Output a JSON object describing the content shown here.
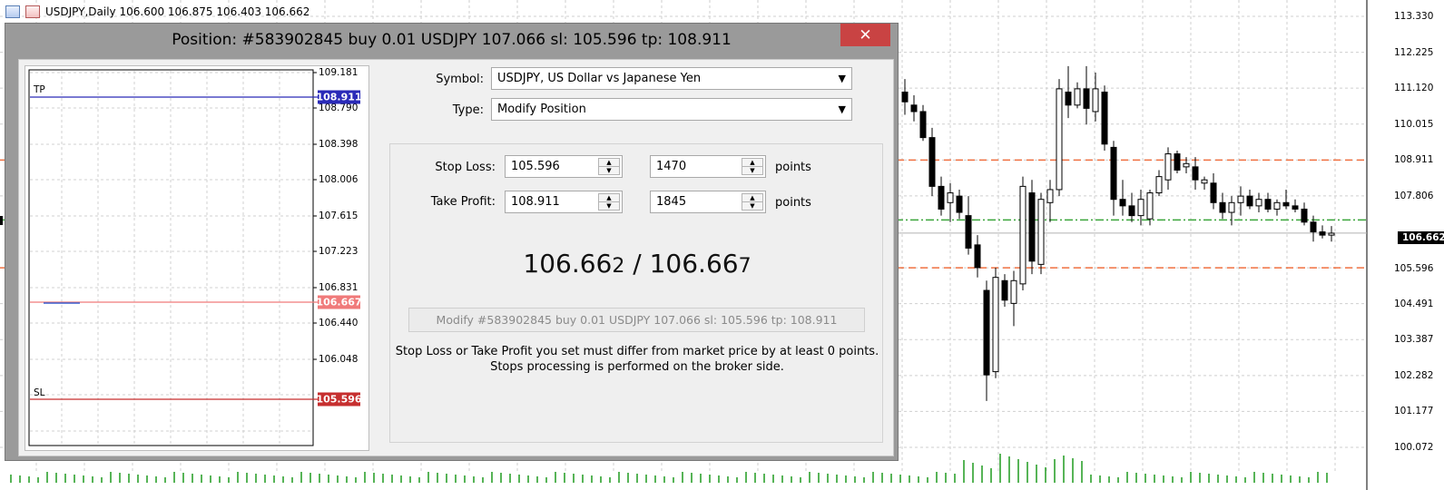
{
  "chart": {
    "title": "USDJPY,Daily  106.600 106.875 106.403 106.662",
    "icon_1": "chart-window-icon",
    "icon_2": "symbol-flag-icon",
    "price_axis": [
      "113.330",
      "112.225",
      "111.120",
      "110.015",
      "108.911",
      "107.806",
      "106.662",
      "105.596",
      "104.491",
      "103.387",
      "102.282",
      "101.177",
      "100.072"
    ],
    "current_price": "106.662",
    "line_colors": {
      "tp_sl": "#f07040",
      "open": "#3aa53a",
      "bid": "#b0b0b0",
      "volume": "#1f9a1f"
    }
  },
  "dialog": {
    "title": "Position: #583902845 buy 0.01 USDJPY 107.066 sl: 105.596 tp: 108.911",
    "close_label": "✕",
    "mini_chart": {
      "ticks": [
        "109.181",
        "108.790",
        "108.398",
        "108.006",
        "107.615",
        "107.223",
        "106.831",
        "106.440",
        "106.048"
      ],
      "tp_tag": "TP",
      "sl_tag": "SL",
      "tp_price": "108.911",
      "current_price": "106.667",
      "sl_price": "105.596",
      "colors": {
        "tp": "#2a2ab8",
        "current": "#f07a7a",
        "sl": "#c62f2f"
      }
    },
    "symbol_label": "Symbol:",
    "symbol_value": "USDJPY, US Dollar vs Japanese Yen",
    "type_label": "Type:",
    "type_value": "Modify Position",
    "stop_loss_label": "Stop Loss:",
    "stop_loss_value": "105.596",
    "stop_loss_points": "1470",
    "take_profit_label": "Take Profit:",
    "take_profit_value": "108.911",
    "take_profit_points": "1845",
    "points_label": "points",
    "quote": {
      "bid_main": "106.66",
      "bid_last": "2",
      "sep": " / ",
      "ask_main": "106.66",
      "ask_last": "7"
    },
    "modify_button": "Modify #583902845 buy 0.01 USDJPY 107.066 sl: 105.596 tp: 108.911",
    "note": "Stop Loss or Take Profit you set must differ from market price by at least 0 points. Stops processing is performed on the broker side."
  }
}
